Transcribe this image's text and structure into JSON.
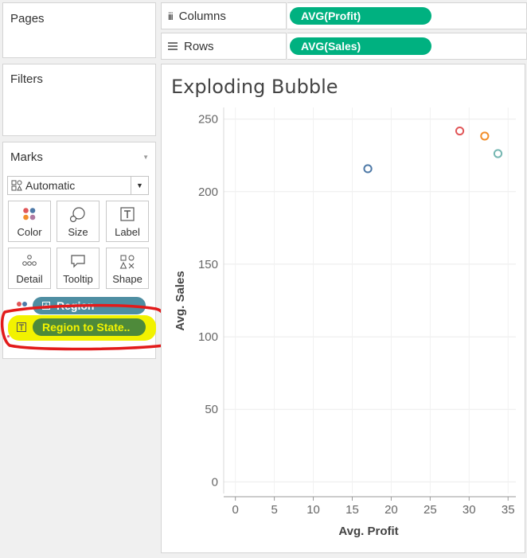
{
  "pages": {
    "title": "Pages"
  },
  "filters": {
    "title": "Filters"
  },
  "columns_shelf": {
    "label": "Columns",
    "pill": "AVG(Profit)"
  },
  "rows_shelf": {
    "label": "Rows",
    "pill": "AVG(Sales)"
  },
  "marks": {
    "title": "Marks",
    "mark_type": "Automatic",
    "buttons": [
      {
        "label": "Color",
        "icon": "color-icon"
      },
      {
        "label": "Size",
        "icon": "size-icon"
      },
      {
        "label": "Label",
        "icon": "label-icon"
      },
      {
        "label": "Detail",
        "icon": "detail-icon"
      },
      {
        "label": "Tooltip",
        "icon": "tooltip-icon"
      },
      {
        "label": "Shape",
        "icon": "shape-icon"
      }
    ],
    "cards": [
      {
        "label": "Region",
        "field_icon": "plus-box-icon",
        "card_icon": "color-icon"
      },
      {
        "label": "Region to State..",
        "card_icon": "label-icon"
      }
    ],
    "colors": {
      "pill_green": "#00b180",
      "pill_blue": "#4e8ea2",
      "highlight": "#f5f500",
      "annotation": "#e02020"
    }
  },
  "chart_data": {
    "type": "scatter",
    "title": "Exploding Bubble",
    "xlabel": "Avg. Profit",
    "ylabel": "Avg. Sales",
    "xlim": [
      -1.5,
      36
    ],
    "ylim": [
      -8,
      258
    ],
    "xticks": [
      0,
      5,
      10,
      15,
      20,
      25,
      30,
      35
    ],
    "yticks": [
      0,
      50,
      100,
      150,
      200,
      250
    ],
    "grid": true,
    "points": [
      {
        "x": 17.0,
        "y": 215.8,
        "color": "#4e79a7"
      },
      {
        "x": 28.8,
        "y": 241.8,
        "color": "#e15759"
      },
      {
        "x": 32.0,
        "y": 238.3,
        "color": "#f28e2b"
      },
      {
        "x": 33.7,
        "y": 226.2,
        "color": "#76b7b2"
      }
    ]
  }
}
